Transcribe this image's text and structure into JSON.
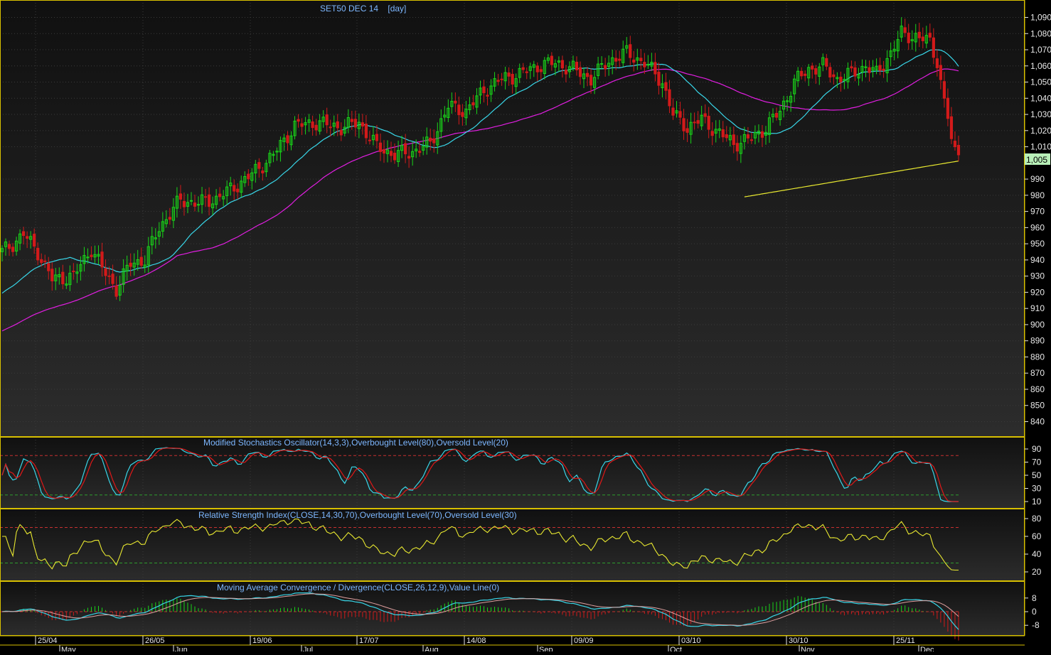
{
  "colors": {
    "background": "#000000",
    "panel_top": "#101010",
    "panel_bottom": "#2c2c2c",
    "border": "#d8c000",
    "axis_text": "#e8e8e8",
    "title_text": "#7db7ff",
    "grid": "#3a3a3a",
    "up_candle": "#19d419",
    "down_candle": "#d21a1a",
    "ma_fast": "#38d6e8",
    "ma_slow": "#e21ee2",
    "ma_long": "#e8e830",
    "osc_fast": "#38d6e8",
    "osc_slow": "#e01818",
    "rsi_line": "#e8e830",
    "overbought": "#c83030",
    "oversold": "#2e9e2e",
    "price_tag_bg": "#b8f0b8"
  },
  "main": {
    "title": "SET50 DEC 14    [day]",
    "last_price_label": "1,005",
    "y_ticks": [
      "1,090",
      "1,080",
      "1,070",
      "1,060",
      "1,050",
      "1,040",
      "1,030",
      "1,020",
      "1,010",
      "990",
      "980",
      "970",
      "960",
      "950",
      "940",
      "930",
      "920",
      "910",
      "900",
      "890",
      "880",
      "870",
      "860",
      "850",
      "840"
    ]
  },
  "stochastic": {
    "title": "Modified Stochastics Oscillator(14,3,3),Overbought Level(80),Oversold Level(20)",
    "y_ticks": [
      "90",
      "70",
      "50",
      "30",
      "10"
    ]
  },
  "rsi": {
    "title": "Relative Strength Index(CLOSE,14,30,70),Overbought Level(70),Oversold Level(30)",
    "y_ticks": [
      "80",
      "60",
      "40",
      "20"
    ]
  },
  "macd": {
    "title": "Moving Average Convergence / Divergence(CLOSE,26,12,9),Value Line(0)",
    "y_ticks": [
      "8",
      "0",
      "-8"
    ]
  },
  "x_axis": {
    "date_labels": [
      "25/04",
      "26/05",
      "19/06",
      "17/07",
      "14/08",
      "09/09",
      "03/10",
      "30/10",
      "25/11"
    ],
    "month_labels": [
      "May",
      "Jun",
      "Jul",
      "Aug",
      "Sep",
      "Oct",
      "Nov",
      "Dec"
    ]
  },
  "chart_data": {
    "type": "candlestick",
    "title": "SET50 DEC 14    [day]",
    "ylim": [
      833,
      1095
    ],
    "last_price": 1005,
    "moving_averages": [
      "fast",
      "slow",
      "long"
    ],
    "stochastic_levels": {
      "overbought": 80,
      "oversold": 20
    },
    "rsi_levels": {
      "overbought": 70,
      "oversold": 30
    },
    "macd_zero_line": 0,
    "approx_close_path": [
      {
        "date": "25/04",
        "close": 950
      },
      {
        "date": "26/05",
        "close": 930
      },
      {
        "date": "19/06",
        "close": 978
      },
      {
        "date": "17/07",
        "close": 1025
      },
      {
        "date": "14/08",
        "close": 1030
      },
      {
        "date": "09/09",
        "close": 1062
      },
      {
        "date": "03/10",
        "close": 1025
      },
      {
        "date": "30/10",
        "close": 1055
      },
      {
        "date": "25/11",
        "close": 1078
      },
      {
        "date": "last",
        "close": 1005
      }
    ]
  }
}
